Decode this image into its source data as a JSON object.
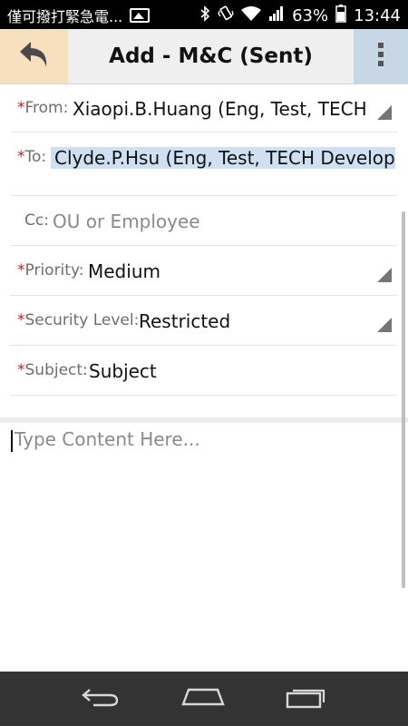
{
  "status_bar": {
    "notification_text": "僅可撥打緊急電...",
    "battery_percent": "63%",
    "time": "13:44"
  },
  "header": {
    "title": "Add - M&C (Sent)",
    "back_icon": "back-arrow-icon",
    "menu_icon": "overflow-menu-icon",
    "back_bg": "#f6e0bd",
    "menu_bg": "#c7d7e6"
  },
  "form": {
    "from": {
      "required_mark": "*",
      "label": "From:",
      "value": "Xiaopi.B.Huang (Eng, Test, TECH."
    },
    "to": {
      "required_mark": "*",
      "label": "To:",
      "value": "Clyde.P.Hsu (Eng, Test, TECH Developr"
    },
    "cc": {
      "label": "Cc:",
      "placeholder": "OU or Employee"
    },
    "priority": {
      "required_mark": "*",
      "label": "Priority:",
      "value": "Medium"
    },
    "security_level": {
      "required_mark": "*",
      "label": "Security Level:",
      "value": "Restricted"
    },
    "subject": {
      "required_mark": "*",
      "label": "Subject:",
      "value": "Subject"
    }
  },
  "content": {
    "placeholder": "Type Content Here..."
  },
  "colors": {
    "required": "#c8201e",
    "chip": "#cfe0f2",
    "navbar": "#333333"
  }
}
